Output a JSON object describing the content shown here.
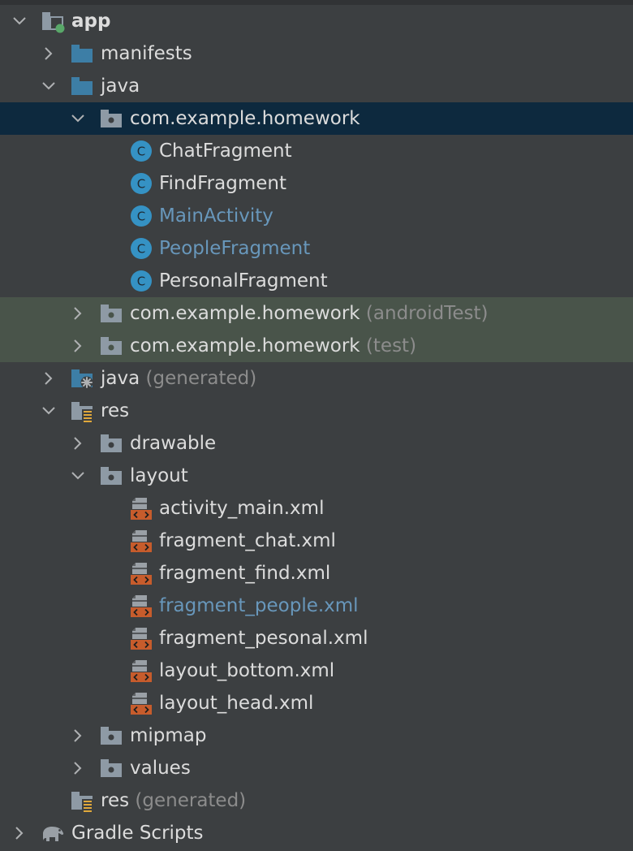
{
  "tree": {
    "app": "app",
    "manifests": "manifests",
    "java": "java",
    "pkg_main": "com.example.homework",
    "class_chat": "ChatFragment",
    "class_find": "FindFragment",
    "class_main": "MainActivity",
    "class_people": "PeopleFragment",
    "class_personal": "PersonalFragment",
    "pkg_android_test": "com.example.homework",
    "pkg_android_test_suffix": "(androidTest)",
    "pkg_test": "com.example.homework",
    "pkg_test_suffix": "(test)",
    "java_generated": "java",
    "java_generated_suffix": "(generated)",
    "res": "res",
    "drawable": "drawable",
    "layout": "layout",
    "xml_activity_main": "activity_main.xml",
    "xml_fragment_chat": "fragment_chat.xml",
    "xml_fragment_find": "fragment_find.xml",
    "xml_fragment_people": "fragment_people.xml",
    "xml_fragment_pesonal": "fragment_pesonal.xml",
    "xml_layout_bottom": "layout_bottom.xml",
    "xml_layout_head": "layout_head.xml",
    "mipmap": "mipmap",
    "values": "values",
    "res_generated": "res",
    "res_generated_suffix": "(generated)",
    "gradle_scripts": "Gradle Scripts"
  },
  "colors": {
    "background": "#3c3f41",
    "selected_row": "#0d293e",
    "test_row": "#49544a",
    "modified_text": "#6897bb",
    "dim_text": "#8c8c8c"
  }
}
